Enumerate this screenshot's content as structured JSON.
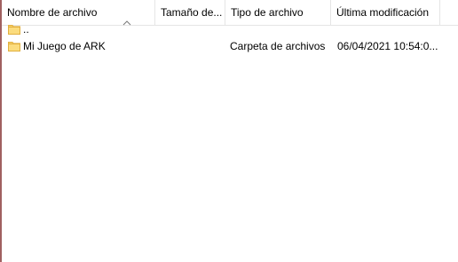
{
  "columns": {
    "name": "Nombre de archivo",
    "size": "Tamaño de...",
    "type": "Tipo de archivo",
    "modified": "Última modificación"
  },
  "rows": [
    {
      "name": "..",
      "size": "",
      "type": "",
      "modified": "",
      "icon": "folder-icon"
    },
    {
      "name": "Mi Juego de ARK",
      "size": "",
      "type": "Carpeta de archivos",
      "modified": "06/04/2021 10:54:0...",
      "icon": "folder-icon"
    }
  ],
  "colors": {
    "folder": "#f7d26a",
    "folder_dark": "#e2b03f",
    "border": "#a06060"
  }
}
